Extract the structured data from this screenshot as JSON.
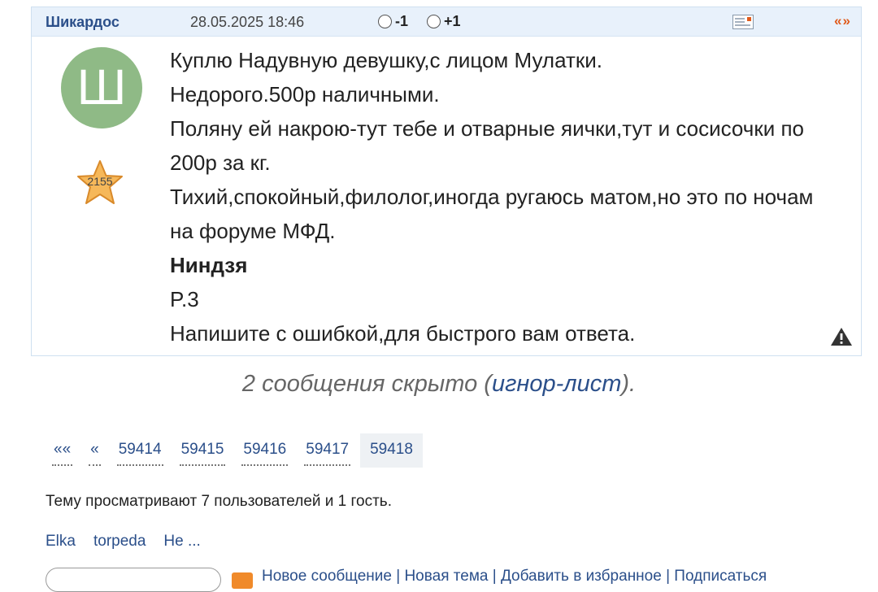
{
  "post": {
    "author": "Шикардос",
    "date": "28.05.2025 18:46",
    "vote_minus": "-1",
    "vote_plus": "+1",
    "quote_label": "«»",
    "avatar_letter": "Ш",
    "avatar_color": "#8fba86",
    "rating": "2155",
    "lines": [
      "Куплю Надувную девушку,с лицом Мулатки.",
      "Недорого.500р наличными.",
      "Поляну ей накрою-тут тебе и отварные яички,тут и сосисочки по 200р за кг.",
      "Тихий,спокойный,филолог,иногда ругаюсь матом,но это по ночам на форуме МФД.",
      "Ниндзя",
      "P.3",
      "Напишите с ошибкой,для быстрого вам ответа."
    ]
  },
  "hidden": {
    "prefix": "2 сообщения скрыто (",
    "link": "игнор-лист",
    "suffix": ")."
  },
  "pager": {
    "first": "««",
    "prev": "«",
    "pages": [
      "59414",
      "59415",
      "59416",
      "59417"
    ],
    "current": "59418"
  },
  "viewers_text": "Тему просматривают 7 пользователей и 1 гость.",
  "users": [
    "Elka",
    "torpeda",
    "Не ..."
  ],
  "bottom_links": "Новое сообщение | Новая тема | Добавить в избранное | Подписаться"
}
